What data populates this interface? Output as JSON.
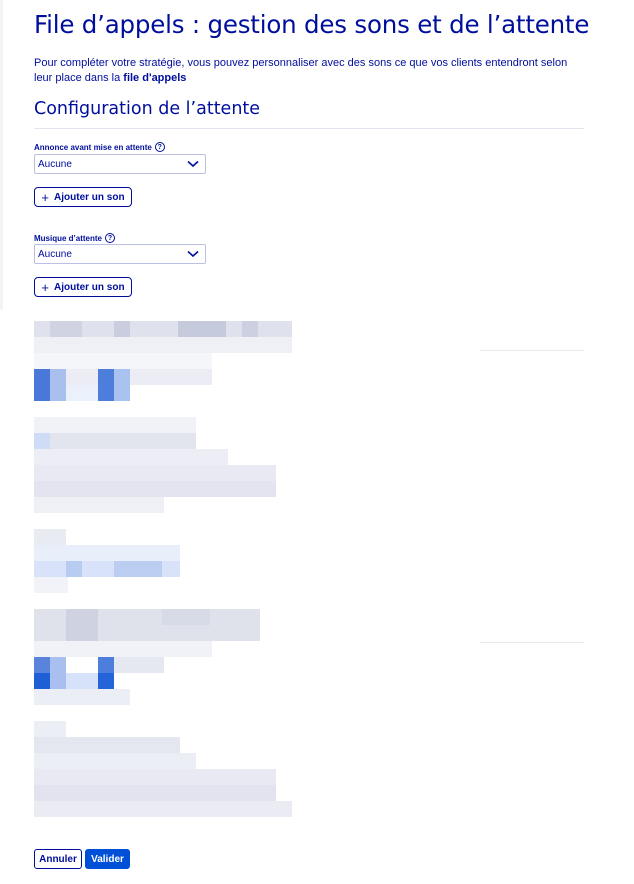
{
  "page": {
    "title": "File d’appels : gestion des sons et de l’attente",
    "intro_text": "Pour compléter votre stratégie, vous pouvez personnaliser avec des sons ce que vos clients entendront selon leur place dans la ",
    "intro_emphasis": "file d'appels"
  },
  "section": {
    "title": "Configuration de l’attente"
  },
  "announcement": {
    "label": "Annonce avant mise en attente",
    "help_icon": "question-circle-icon",
    "selected": "Aucune",
    "add_label": "Ajouter un son"
  },
  "hold_music": {
    "label": "Musique d’attente",
    "help_icon": "question-circle-icon",
    "selected": "Aucune",
    "add_label": "Ajouter un son"
  },
  "footer": {
    "cancel_label": "Annuler",
    "confirm_label": "Valider"
  },
  "colors": {
    "primary": "#000e9c",
    "accent": "#0050d7",
    "border": "#bbbfe4"
  }
}
